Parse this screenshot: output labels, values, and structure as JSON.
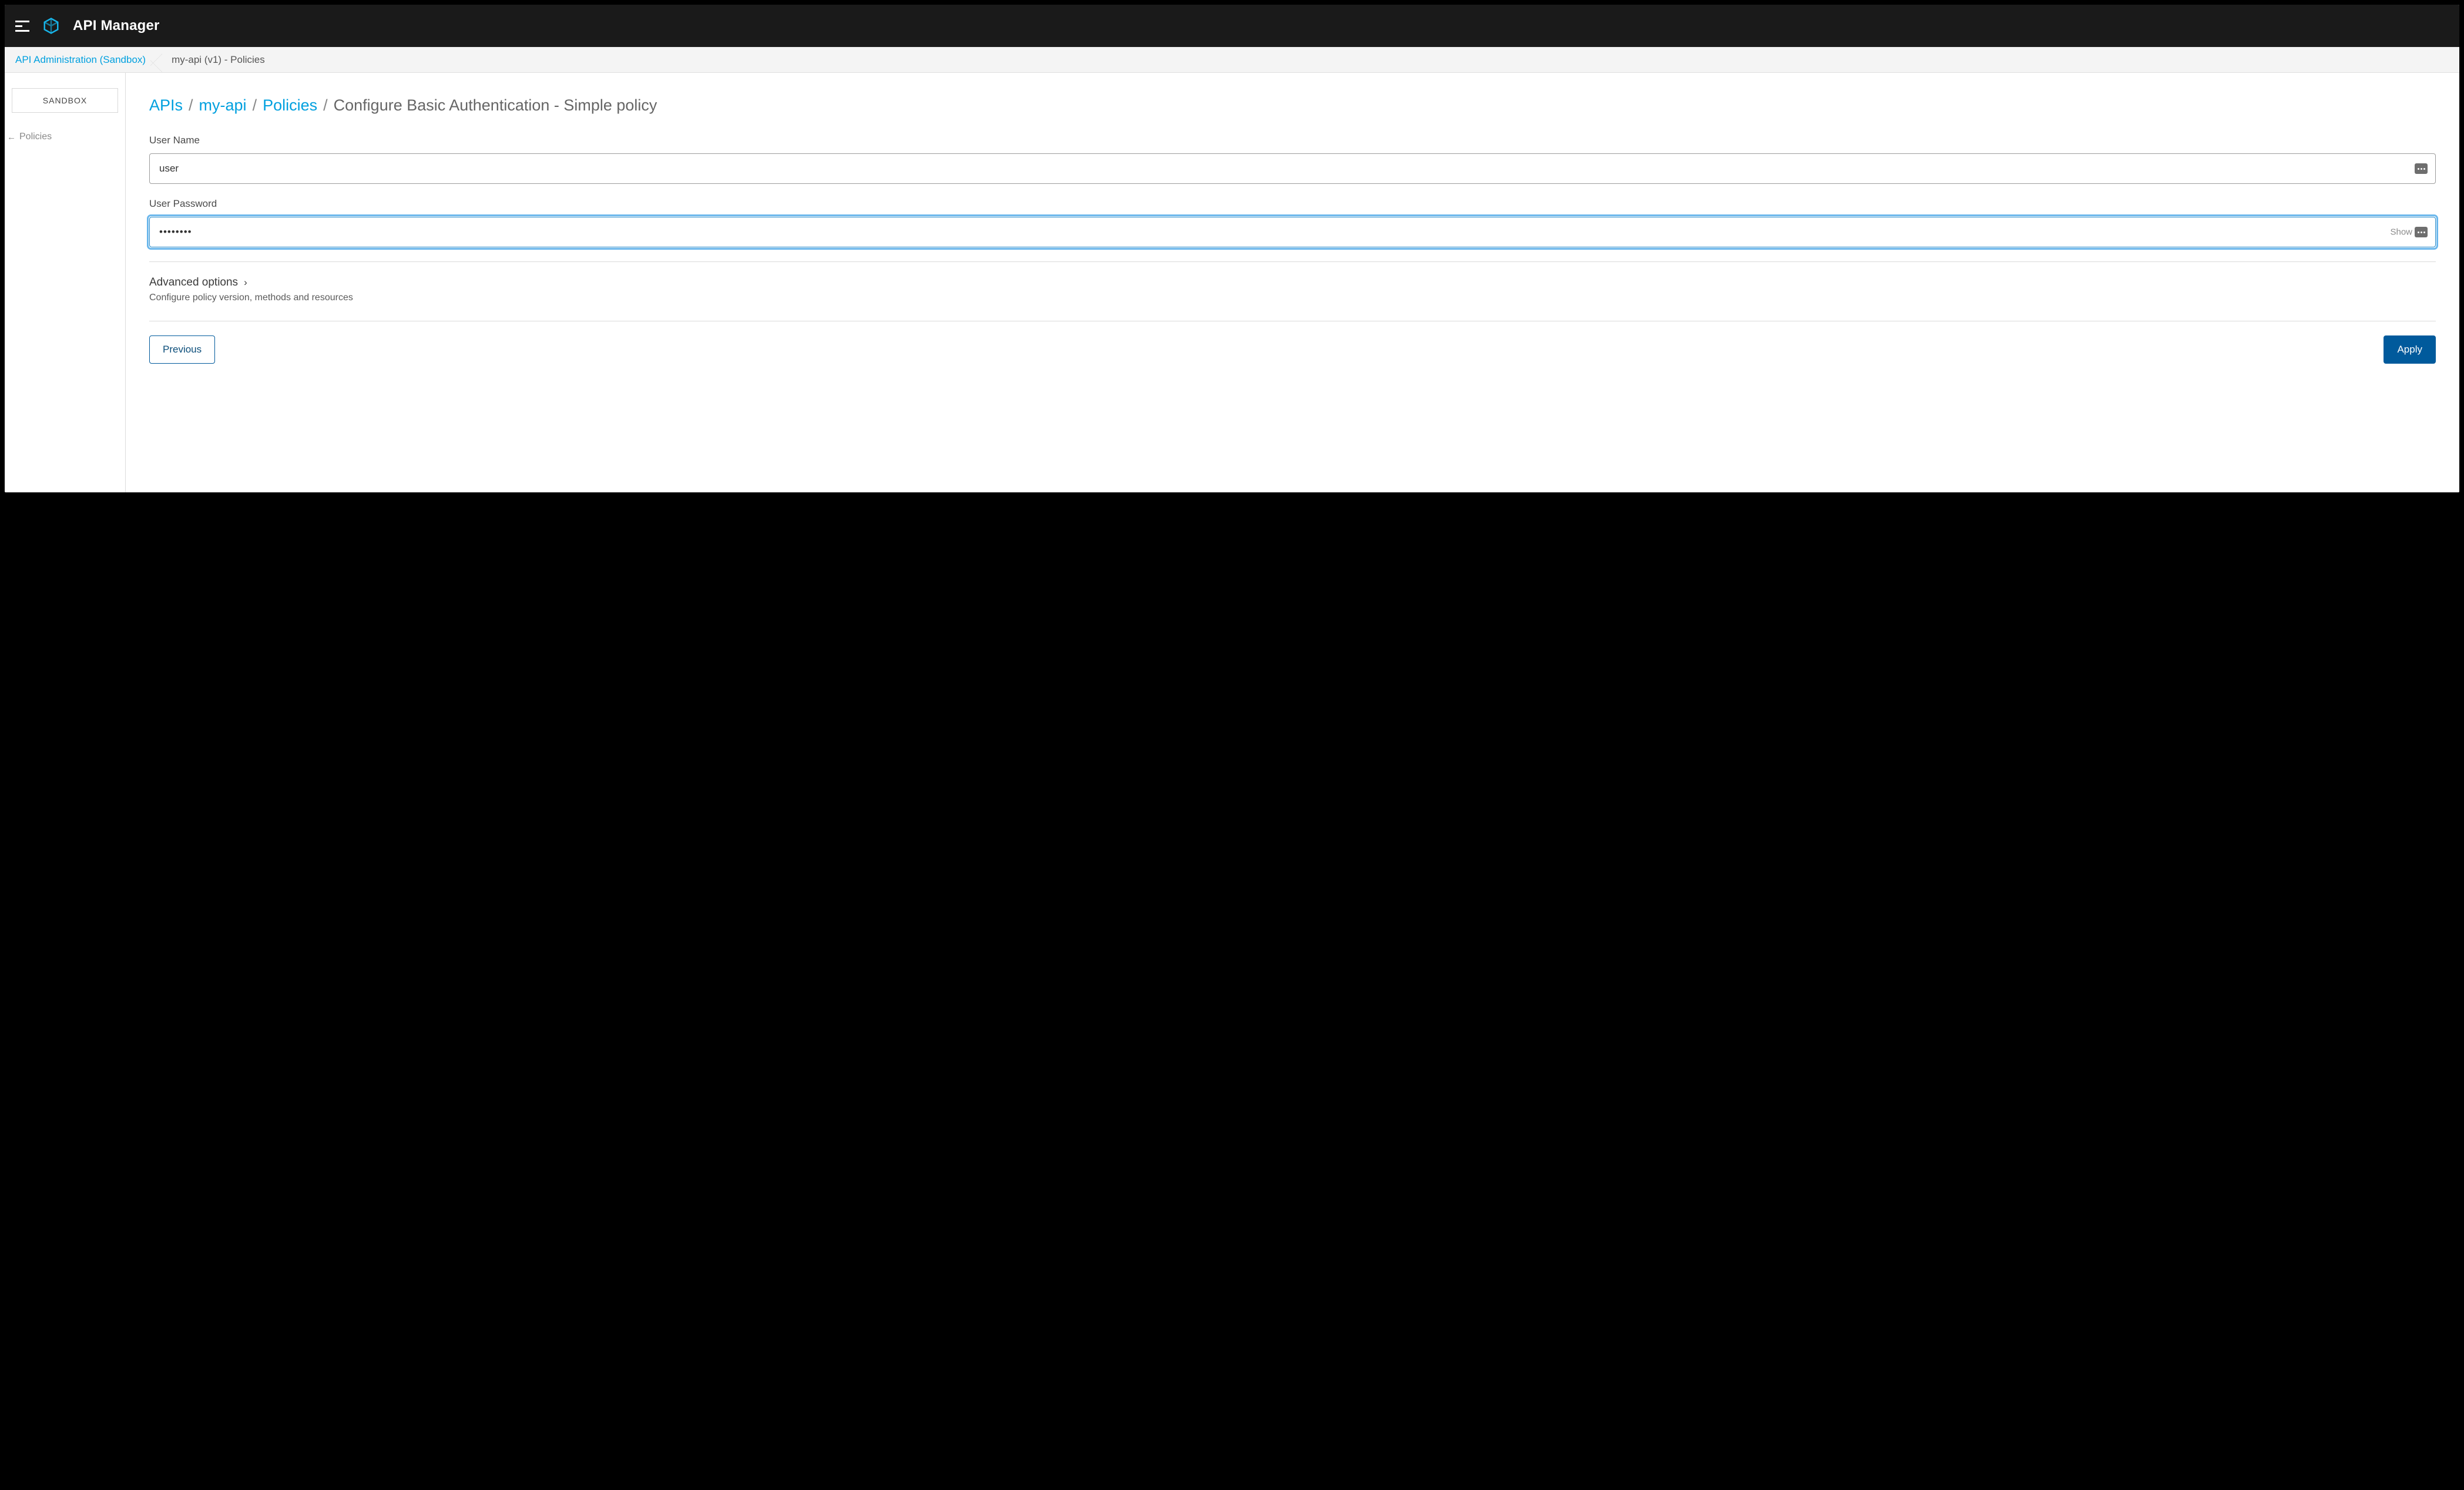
{
  "header": {
    "app_title": "API Manager"
  },
  "crumb_strip": {
    "root": "API Administration (Sandbox)",
    "current": "my-api (v1) - Policies"
  },
  "sidebar": {
    "env_label": "SANDBOX",
    "back_link": "Policies"
  },
  "page_breadcrumb": {
    "items": [
      "APIs",
      "my-api",
      "Policies"
    ],
    "current": "Configure Basic Authentication - Simple policy"
  },
  "form": {
    "username_label": "User Name",
    "username_value": "user",
    "password_label": "User Password",
    "password_value": "••••••••",
    "show_label": "Show"
  },
  "advanced": {
    "title": "Advanced options",
    "subtitle": "Configure policy version, methods and resources"
  },
  "buttons": {
    "previous": "Previous",
    "apply": "Apply"
  }
}
